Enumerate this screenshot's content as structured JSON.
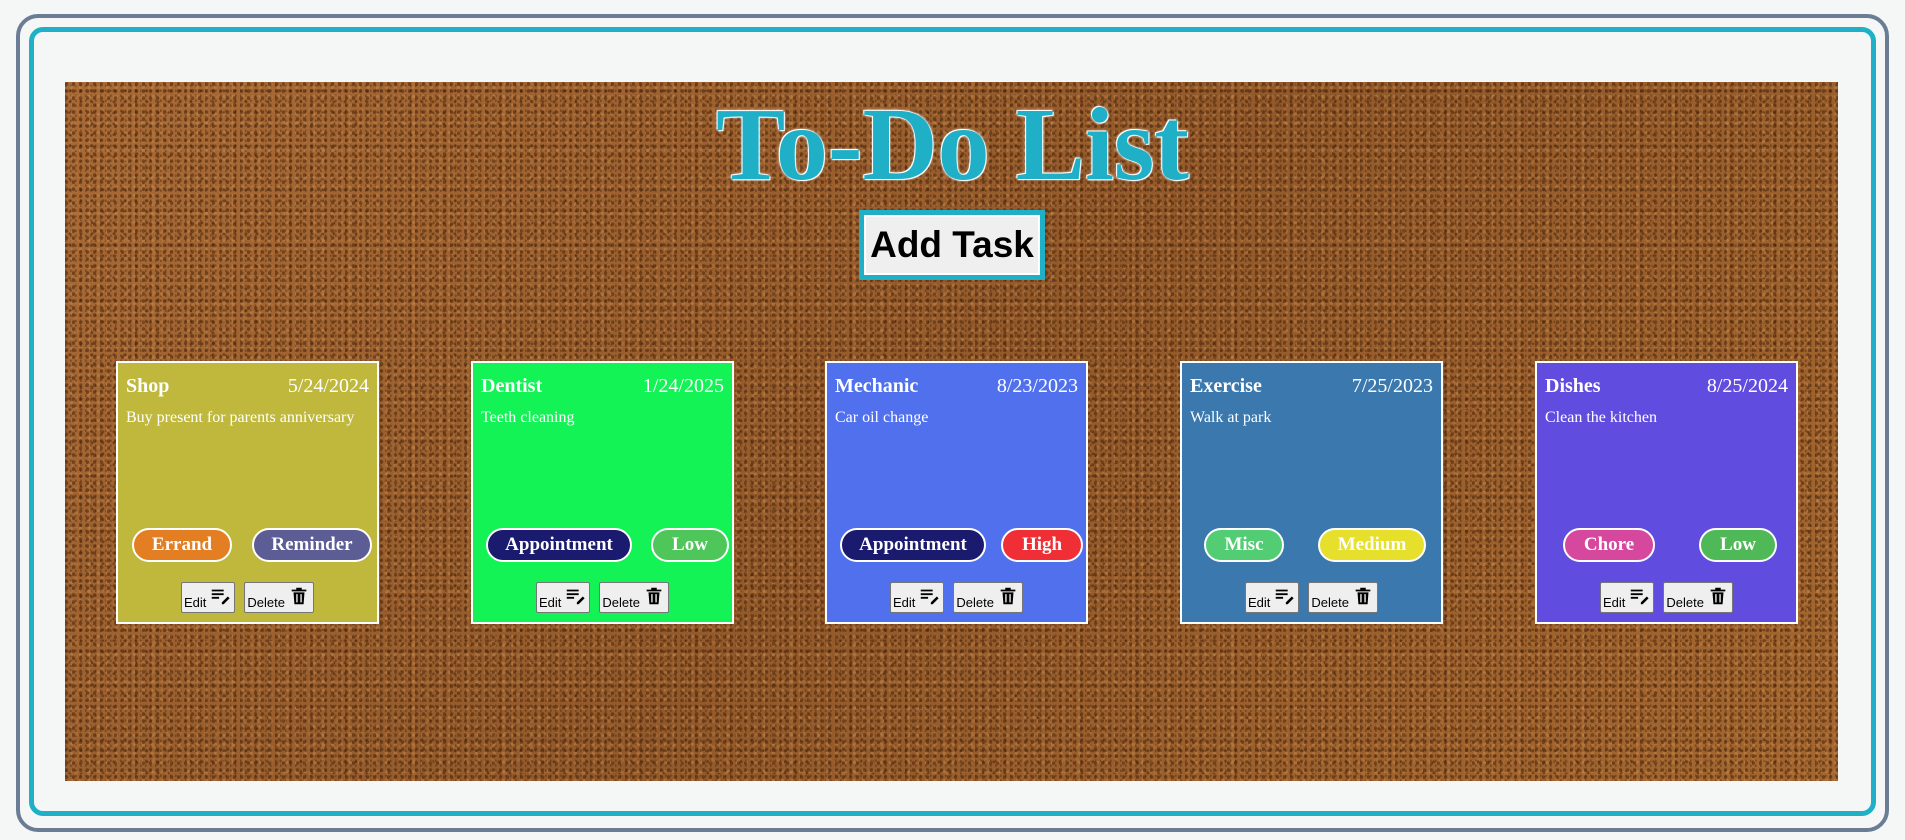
{
  "header": {
    "title": "To-Do List",
    "add_task_label": "Add Task"
  },
  "colors": {
    "accent": "#1fb0c8",
    "frame": "#6b7d94",
    "board": "#9e6330"
  },
  "cards": [
    {
      "name": "Shop",
      "date": "5/24/2024",
      "description": "Buy present for parents anniversary",
      "color": "#bfb83d",
      "tags": [
        {
          "label": "Errand",
          "color": "#e37e22"
        },
        {
          "label": "Reminder",
          "color": "#5d5d95"
        }
      ],
      "edit_label": "Edit",
      "delete_label": "Delete"
    },
    {
      "name": "Dentist",
      "date": "1/24/2025",
      "description": "Teeth cleaning",
      "color": "#14f356",
      "tags": [
        {
          "label": "Appointment",
          "color": "#1a1a6e"
        },
        {
          "label": "Low",
          "color": "#4fc65a"
        }
      ],
      "edit_label": "Edit",
      "delete_label": "Delete"
    },
    {
      "name": "Mechanic",
      "date": "8/23/2023",
      "description": "Car oil change",
      "color": "#5070ee",
      "tags": [
        {
          "label": "Appointment",
          "color": "#1a1a6e"
        },
        {
          "label": "High",
          "color": "#ef2f35"
        }
      ],
      "edit_label": "Edit",
      "delete_label": "Delete"
    },
    {
      "name": "Exercise",
      "date": "7/25/2023",
      "description": "Walk at park",
      "color": "#3a78ae",
      "tags": [
        {
          "label": "Misc",
          "color": "#53cd74"
        },
        {
          "label": "Medium",
          "color": "#e6e02c"
        }
      ],
      "edit_label": "Edit",
      "delete_label": "Delete"
    },
    {
      "name": "Dishes",
      "date": "8/25/2024",
      "description": "Clean the kitchen",
      "color": "#604ddf",
      "tags": [
        {
          "label": "Chore",
          "color": "#d6479e"
        },
        {
          "label": "Low",
          "color": "#4fb857"
        }
      ],
      "edit_label": "Edit",
      "delete_label": "Delete"
    }
  ]
}
